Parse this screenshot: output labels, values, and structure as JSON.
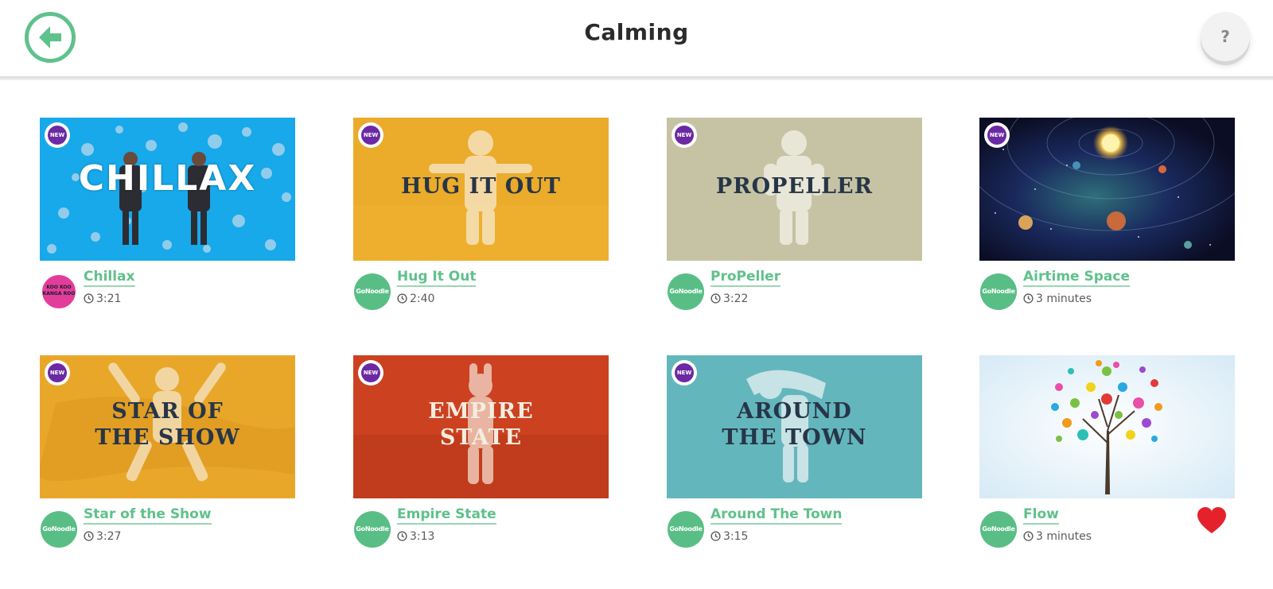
{
  "header": {
    "title": "Calming",
    "back_icon": "arrow-left-icon",
    "help_label": "?",
    "accent_color": "#5fc18b"
  },
  "badge_label": "NEW",
  "videos": [
    {
      "title": "Chillax",
      "duration": "3:21",
      "thumb_text": "CHILLAX",
      "channel": "KOO KOO KANGA ROO",
      "is_new": true,
      "bg": "#17a9ea"
    },
    {
      "title": "Hug It Out",
      "duration": "2:40",
      "thumb_text": "HUG IT OUT",
      "channel": "GoNoodle",
      "is_new": true,
      "bg": "#ebab2b"
    },
    {
      "title": "ProPeller",
      "duration": "3:22",
      "thumb_text": "PROPELLER",
      "channel": "GoNoodle",
      "is_new": true,
      "bg": "#c6c3a4"
    },
    {
      "title": "Airtime Space",
      "duration": "3 minutes",
      "thumb_text": "",
      "channel": "GoNoodle",
      "is_new": true,
      "bg": "#10133a"
    },
    {
      "title": "Star of the Show",
      "duration": "3:27",
      "thumb_text_1": "STAR OF",
      "thumb_text_2": "THE SHOW",
      "channel": "GoNoodle",
      "is_new": true,
      "bg": "#e9a72a"
    },
    {
      "title": "Empire State",
      "duration": "3:13",
      "thumb_text_1": "EMPIRE",
      "thumb_text_2": "STATE",
      "channel": "GoNoodle",
      "is_new": true,
      "bg": "#cc4120"
    },
    {
      "title": "Around The Town",
      "duration": "3:15",
      "thumb_text_1": "AROUND",
      "thumb_text_2": "THE TOWN",
      "channel": "GoNoodle",
      "is_new": true,
      "bg": "#64b6bd"
    },
    {
      "title": "Flow",
      "duration": "3 minutes",
      "thumb_text": "",
      "channel": "GoNoodle",
      "is_new": false,
      "favorited": true,
      "bg": "#e4f1f9"
    }
  ]
}
